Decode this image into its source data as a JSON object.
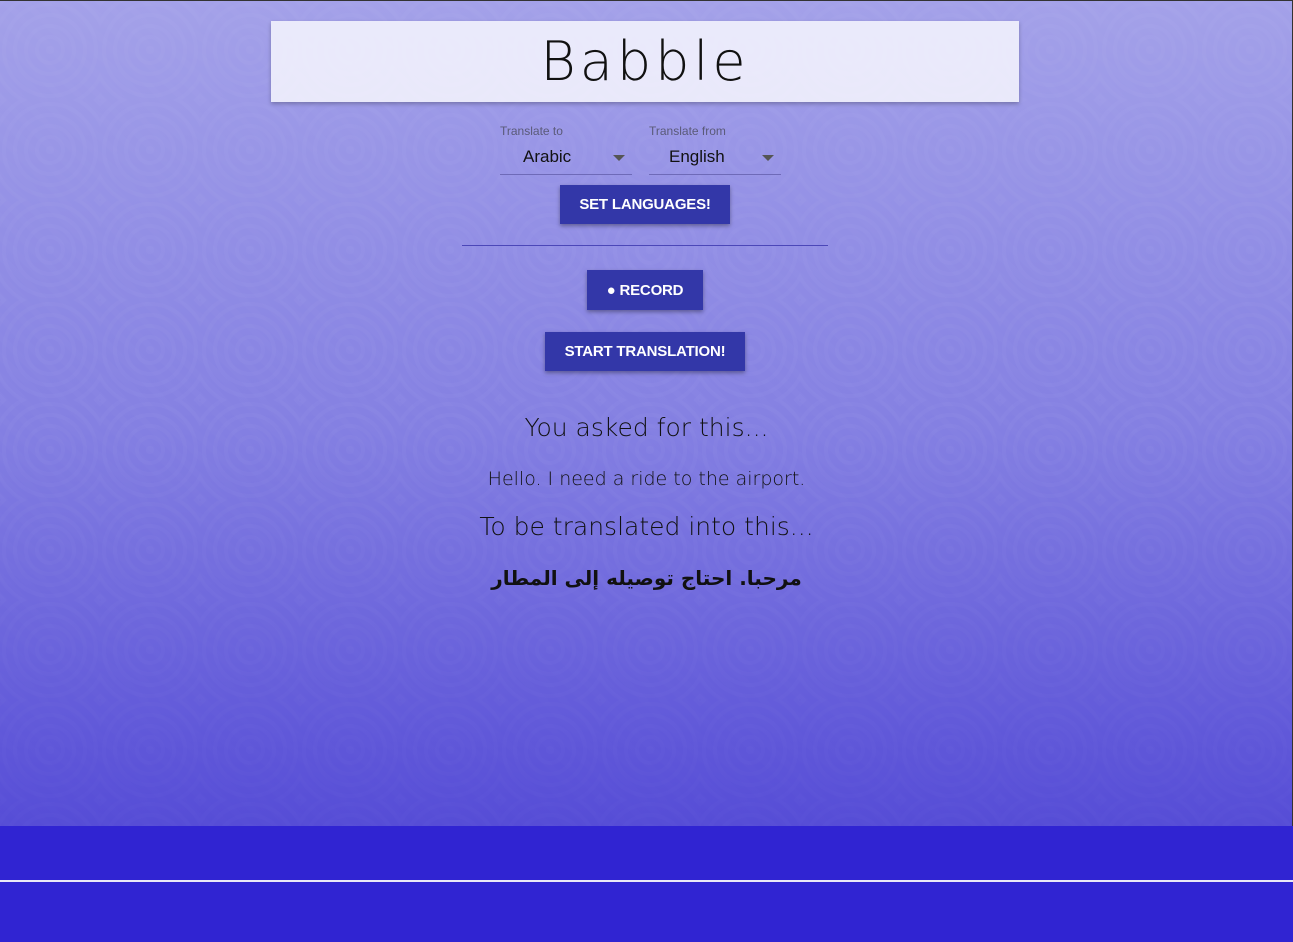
{
  "header": {
    "brand": "Babble"
  },
  "language_select": {
    "to": {
      "label": "Translate to",
      "value": "Arabic"
    },
    "from": {
      "label": "Translate from",
      "value": "English"
    }
  },
  "buttons": {
    "set_languages": "SET LANGUAGES!",
    "record": "● RECORD",
    "start_translation": "START TRANSLATION!"
  },
  "result": {
    "asked_heading": "You asked for this...",
    "asked_text": "Hello. I need a ride to the airport.",
    "translated_heading": "To be translated into this...",
    "translated_text": "مرحبا. احتاج توصيله إلى المطار"
  },
  "colors": {
    "button_bg": "#3337a8",
    "footer_bg": "#3024d2"
  }
}
